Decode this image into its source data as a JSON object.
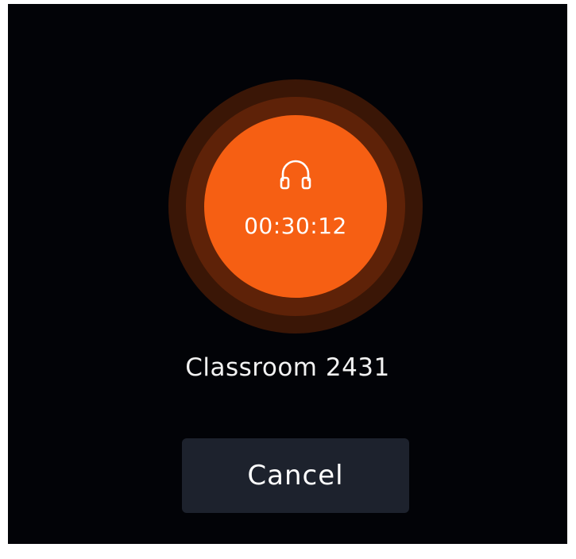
{
  "call": {
    "timer": "00:30:12",
    "icon": "headphones-icon",
    "room_name": "Classroom 2431"
  },
  "actions": {
    "cancel_label": "Cancel"
  },
  "colors": {
    "background": "#020307",
    "accent": "#f65f13",
    "ring_mid": "#5e2208",
    "ring_outer": "#3a1606",
    "button_bg": "#1d222d",
    "text": "#ffffff"
  }
}
